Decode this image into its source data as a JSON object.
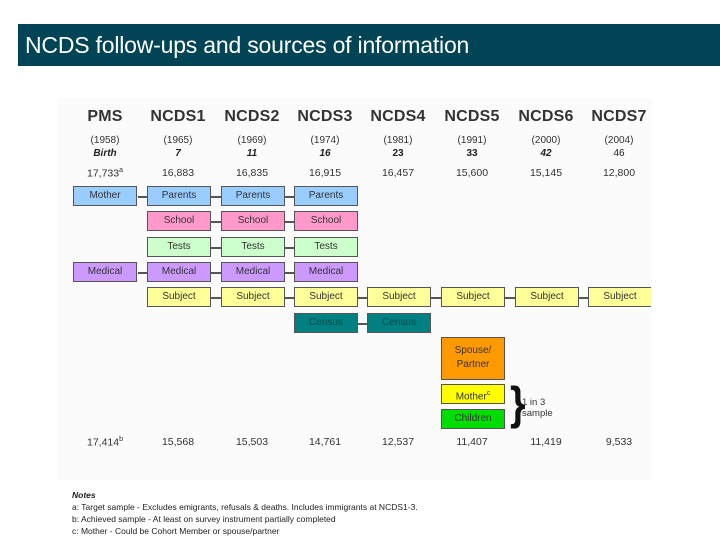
{
  "title": "NCDS follow-ups and sources of information",
  "waves": [
    {
      "name": "PMS",
      "year": "(1958)",
      "age": "Birth",
      "target": "17,733",
      "target_note": "a",
      "achieved": "17,414",
      "achieved_note": "b"
    },
    {
      "name": "NCDS1",
      "year": "(1965)",
      "age": "7",
      "target": "16,883",
      "achieved": "15,568"
    },
    {
      "name": "NCDS2",
      "year": "(1969)",
      "age": "11",
      "target": "16,835",
      "achieved": "15,503"
    },
    {
      "name": "NCDS3",
      "year": "(1974)",
      "age": "16",
      "target": "16,915",
      "achieved": "14,761"
    },
    {
      "name": "NCDS4",
      "year": "(1981)",
      "age": "23",
      "target": "16,457",
      "achieved": "12,537"
    },
    {
      "name": "NCDS5",
      "year": "(1991)",
      "age": "33",
      "target": "15,600",
      "achieved": "11,407"
    },
    {
      "name": "NCDS6",
      "year": "(2000)",
      "age": "42",
      "target": "15,145",
      "achieved": "11,419"
    },
    {
      "name": "NCDS7",
      "year": "(2004)",
      "age": "46",
      "target": "12,800",
      "achieved": "9,533"
    }
  ],
  "colors": {
    "title_bg": "#004455",
    "parents": "#99ccff",
    "school": "#ff99cc",
    "tests": "#ccffcc",
    "medical": "#cc99ff",
    "subject": "#ffff99",
    "census": "#008080",
    "spouse": "#ff9900",
    "mother_c": "#ffff00",
    "children": "#00dd00"
  },
  "rows": {
    "parents": {
      "labels": [
        "Mother",
        "Parents",
        "Parents",
        "Parents"
      ]
    },
    "school": {
      "label": "School"
    },
    "tests": {
      "label": "Tests"
    },
    "medical": {
      "label": "Medical"
    },
    "subject": {
      "label": "Subject"
    },
    "census": {
      "label": "Census"
    },
    "spouse": {
      "label": "Spouse/ Partner"
    },
    "mother_c": {
      "label": "Mother",
      "note": "c"
    },
    "children": {
      "label": "Children"
    }
  },
  "sample_note": "1 in 3 sample",
  "notes": {
    "heading": "Notes",
    "lines": [
      "a: Target sample - Excludes emigrants, refusals & deaths.  Includes immigrants at NCDS1-3.",
      "b: Achieved sample - At least on survey instrument partially completed",
      "c: Mother - Could be Cohort Member or spouse/partner"
    ]
  }
}
